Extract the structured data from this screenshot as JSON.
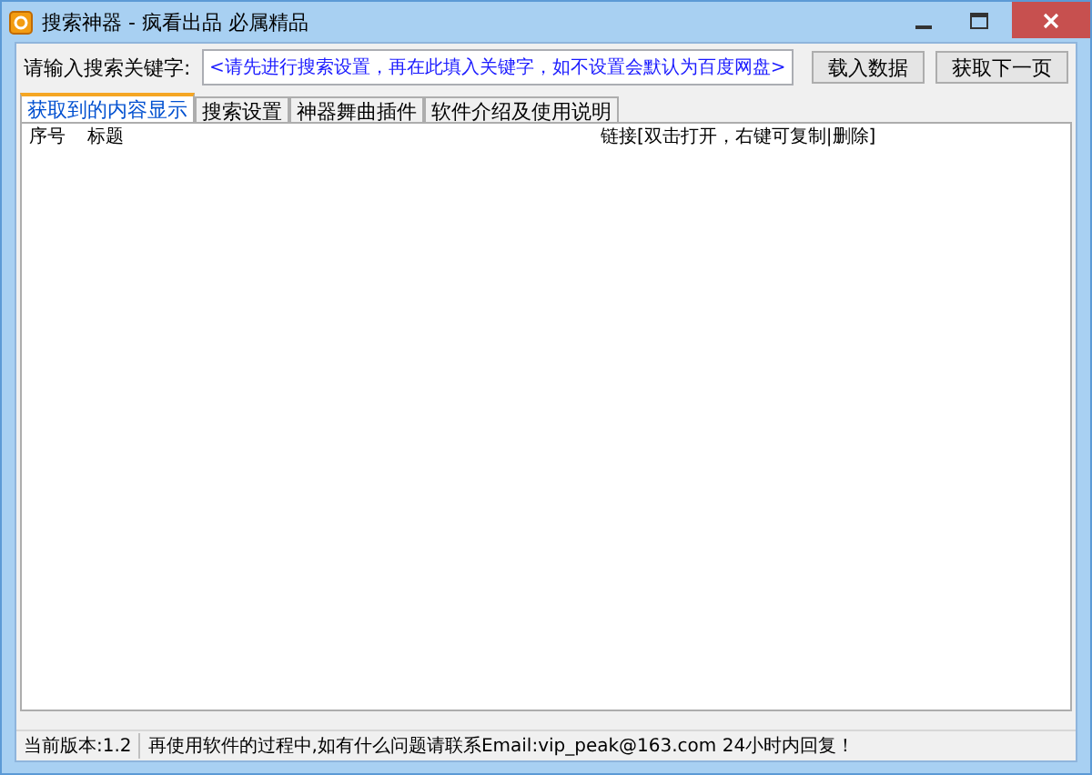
{
  "window": {
    "title": "搜索神器 - 疯看出品 必属精品"
  },
  "search": {
    "label": "请输入搜索关键字:",
    "placeholder": "<请先进行搜索设置，再在此填入关键字，如不设置会默认为百度网盘>"
  },
  "buttons": [
    "载入数据",
    "获取下一页"
  ],
  "tabs": [
    {
      "label": "获取到的内容显示",
      "selected": true
    },
    {
      "label": "搜索设置",
      "selected": false
    },
    {
      "label": "神器舞曲插件",
      "selected": false
    },
    {
      "label": "软件介绍及使用说明",
      "selected": false
    }
  ],
  "table": {
    "columns": [
      "序号",
      "标题",
      "链接[双击打开，右键可复制|删除]"
    ]
  },
  "status_bar": [
    "当前版本:1.2",
    "再使用软件的过程中,如有什么问题请联系Email:vip_peak@163.com 24小时内回复！"
  ]
}
